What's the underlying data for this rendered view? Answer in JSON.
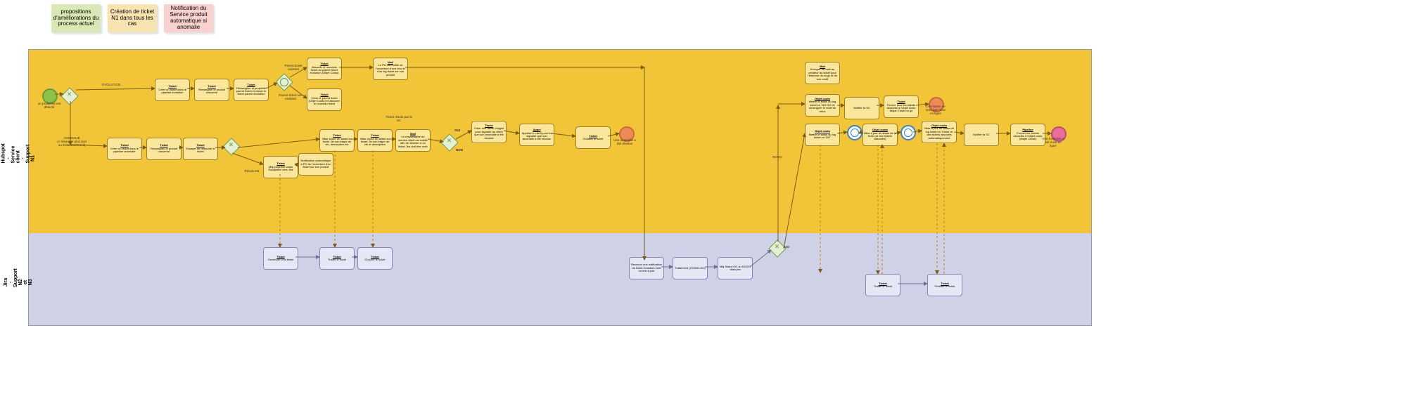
{
  "stickies": {
    "green": "propositions d'améliorations du process actuel",
    "orange": "Création de ticket N1 dans tous les cas",
    "pink": "Notification du Service produit automatique si anomalie"
  },
  "lanes": {
    "top": "Hubspot - Service client - Support N1",
    "bot": "Jira - Support N2 et N3"
  },
  "labels": {
    "evolution": "EVOLUTION",
    "anomalie": "ANOMALIE\n(A résoudre plus tard\nou instantanément)",
    "start_note": "un problème est\ndétecté",
    "oui": "OUI",
    "non": "NON",
    "go": "GO",
    "nogo": "NOGO",
    "parent_existant": "Parent ticket existant",
    "parent_non": "Parent ticket non existant",
    "ticket_resolu": "Ticket résolu par le SC",
    "resolu_n2": "Résolu N2",
    "end_anomalie": "Une anomalie a\nété résolue",
    "end_evo_no": "L'évolution ne\nsera pas mise en\nligne",
    "end_evo_yes": "Une évolution a\nété mise en ligne"
  },
  "tasks": {
    "t_evo_create": {
      "t": "Ticket",
      "b": "Créer un ticket dans le pipeline évolution"
    },
    "t_renseigner": {
      "t": "Ticket",
      "b": "Renseigner le produit concerné"
    },
    "t_renseigner2": {
      "t": "Ticket",
      "b": "Renseigner la propriété parent ticket et cloner le ticket parent évolution"
    },
    "t_associer": {
      "t": "Ticket",
      "b": "Associer le nouveau ticket au parent ticket évolution (Objet Custo)"
    },
    "t_mail_po": {
      "t": "Mail",
      "b": "Le PO est notifié de l'ouverture d'une évo et d'un log ticket sur son produit"
    },
    "t_parent": {
      "t": "Ticket",
      "b": "Créer le parent ticket (Objet Custo) et associer le nouveau ticket"
    },
    "t_ano_create": {
      "t": "Ticket",
      "b": "Créer un ticket dans le pipeline anomalie"
    },
    "t_ano_rens": {
      "t": "Ticket",
      "b": "Renseigner le produit concerné"
    },
    "t_ano_try": {
      "t": "Ticket",
      "b": "Essayer de résoudre le ticket"
    },
    "t_maj1": {
      "t": "Ticket",
      "b": "Mise à jour du statut du ticket, de son étape de vie, description etc"
    },
    "t_maj2": {
      "t": "Ticket",
      "b": "Mise à jour du statut du ticket, de son étape de vie et description"
    },
    "t_mail_resp": {
      "t": "Mail",
      "b": "Le responsable du service client est notifié afin de décider si un ticket Jira doit être créé"
    },
    "t_tache": {
      "t": "Tâche",
      "b": "Créer une tâche d'appel pour signaler au client que son anomalie a été résolue"
    },
    "t_appel": {
      "t": "Appel",
      "b": "Appeler le client pour lui signaler que son anomalie a été résolue"
    },
    "t_cloturer": {
      "t": "Ticket",
      "b": "Clôturer le ticket"
    },
    "t_notif_po": {
      "t": "",
      "b": "Notification automatique à PO de l'ouverture d'un ticket sur son produit"
    },
    "t_maj_custo": {
      "t": "Ticket",
      "b": "Màj propriété custo 'Escalation vers Jira'"
    },
    "t_mail_crea": {
      "t": "Mail",
      "b": "Envoyer un mail au créateur du ticket pour l'informer du nogo et de son motif"
    },
    "t_obj_nogo": {
      "t": "Objet custo",
      "b": "Mettre le statut du log ticket en 'NO GO' et renseigner le motif de refus"
    },
    "t_notif_sc": {
      "t": "",
      "b": "Notifier la SC"
    },
    "t_close_nogo": {
      "t": "Ticket",
      "b": "Fermer tous les tickets associés à l'objet custo étape Closé no go"
    },
    "t_obj_go": {
      "t": "Objet custo",
      "b": "Mettre le statut du log ticket en 'GO'"
    },
    "t_obj_fiche": {
      "t": "Objet custo",
      "b": "Mise à jour du statut de la fiche (et des tickets associés)"
    },
    "t_obj_close": {
      "t": "Objet custo",
      "b": "Mise à jour du statut du log ticket en 'Close' et des tickets associés automatiquement"
    },
    "t_notif_sc2": {
      "t": "",
      "b": "Notifier la SC"
    },
    "t_pipeline": {
      "t": "Pipeline",
      "b": "Fermer les tickets associés à l'objet custo (étape Close)"
    },
    "j_open": {
      "t": "Ticket",
      "b": "Ouverture d'un ticket"
    },
    "j_traiter": {
      "t": "Ticket",
      "b": "Traiter le ticket"
    },
    "j_cloturer": {
      "t": "Ticket",
      "b": "Cloturer le ticket"
    },
    "j_recv": {
      "t": "",
      "b": "Recevoir une notification du ticket évolution créé ou mis à jour"
    },
    "j_trait": {
      "t": "",
      "b": "Traitement (GO/NO-GO)"
    },
    "j_maj": {
      "t": "",
      "b": "Màj Statut GO ou NOGO dans jira"
    },
    "j_traiter2": {
      "t": "Ticket",
      "b": "Traiter le ticket"
    },
    "j_cloturer2": {
      "t": "Ticket",
      "b": "Cloturer le ticket"
    }
  },
  "chart_data": {
    "type": "diagram",
    "notation": "BPMN",
    "pools": [
      {
        "name": "Hubspot - Service client - Support N1",
        "color": "#f2c437"
      },
      {
        "name": "Jira - Support N2 et N3",
        "color": "#cfd1e6"
      }
    ],
    "start_events": [
      "un problème est détecté"
    ],
    "end_events": [
      "Une anomalie a été résolue",
      "L'évolution ne sera pas mise en ligne",
      "Une évolution a été mise en ligne"
    ],
    "gateways": [
      {
        "id": "gw1",
        "type": "exclusive",
        "branches": [
          "EVOLUTION",
          "ANOMALIE"
        ]
      },
      {
        "id": "gw2",
        "type": "inclusive",
        "branches": [
          "Parent ticket existant",
          "Parent ticket non existant"
        ]
      },
      {
        "id": "gw3",
        "type": "exclusive",
        "branches": [
          "Ticket résolu par le SC",
          "Résolu N2"
        ]
      },
      {
        "id": "gw4",
        "type": "exclusive",
        "branches": [
          "OUI",
          "NON"
        ]
      },
      {
        "id": "gw5",
        "type": "exclusive",
        "branches": [
          "GO",
          "NOGO"
        ]
      }
    ],
    "message_flows_between_pools": 8,
    "timer_events": 2
  }
}
